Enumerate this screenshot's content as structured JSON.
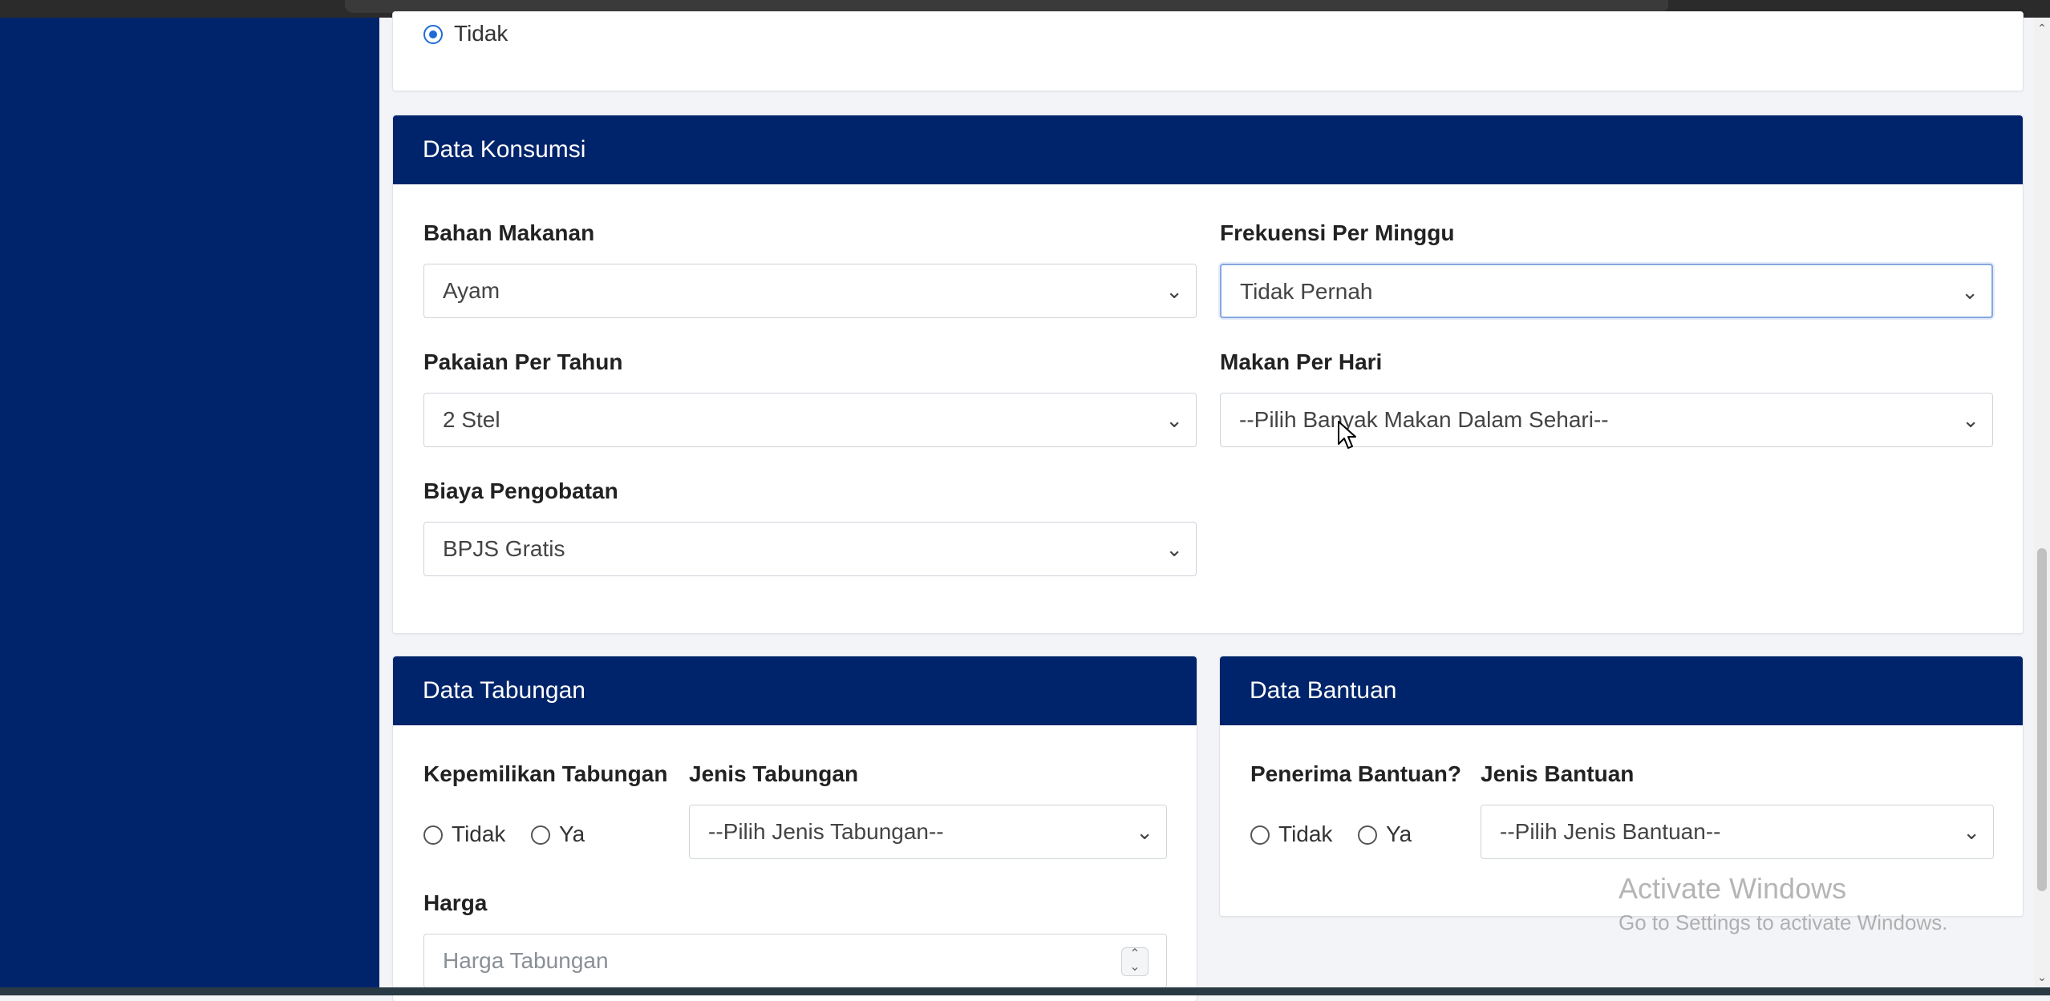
{
  "top_card": {
    "radio_tidak_label": "Tidak"
  },
  "konsumsi": {
    "header": "Data Konsumsi",
    "bahan_makanan": {
      "label": "Bahan Makanan",
      "value": "Ayam"
    },
    "frekuensi": {
      "label": "Frekuensi Per Minggu",
      "value": "Tidak Pernah"
    },
    "pakaian": {
      "label": "Pakaian Per Tahun",
      "value": "2 Stel"
    },
    "makan_per_hari": {
      "label": "Makan Per Hari",
      "value": "--Pilih Banyak Makan Dalam Sehari--"
    },
    "biaya_pengobatan": {
      "label": "Biaya Pengobatan",
      "value": "BPJS Gratis"
    }
  },
  "tabungan": {
    "header": "Data Tabungan",
    "kepemilikan_label": "Kepemilikan Tabungan",
    "radio_tidak": "Tidak",
    "radio_ya": "Ya",
    "jenis_label": "Jenis Tabungan",
    "jenis_value": "--Pilih Jenis Tabungan--",
    "harga_label": "Harga",
    "harga_placeholder": "Harga Tabungan"
  },
  "bantuan": {
    "header": "Data Bantuan",
    "penerima_label": "Penerima Bantuan?",
    "radio_tidak": "Tidak",
    "radio_ya": "Ya",
    "jenis_label": "Jenis Bantuan",
    "jenis_value": "--Pilih Jenis Bantuan--"
  },
  "watermark": {
    "title": "Activate Windows",
    "subtitle": "Go to Settings to activate Windows."
  },
  "icons": {
    "chevron": "chevron-down-icon",
    "radio": "radio-icon",
    "cursor": "mouse-pointer-icon"
  },
  "colors": {
    "navy": "#00246b",
    "accent": "#1e6bd6"
  }
}
